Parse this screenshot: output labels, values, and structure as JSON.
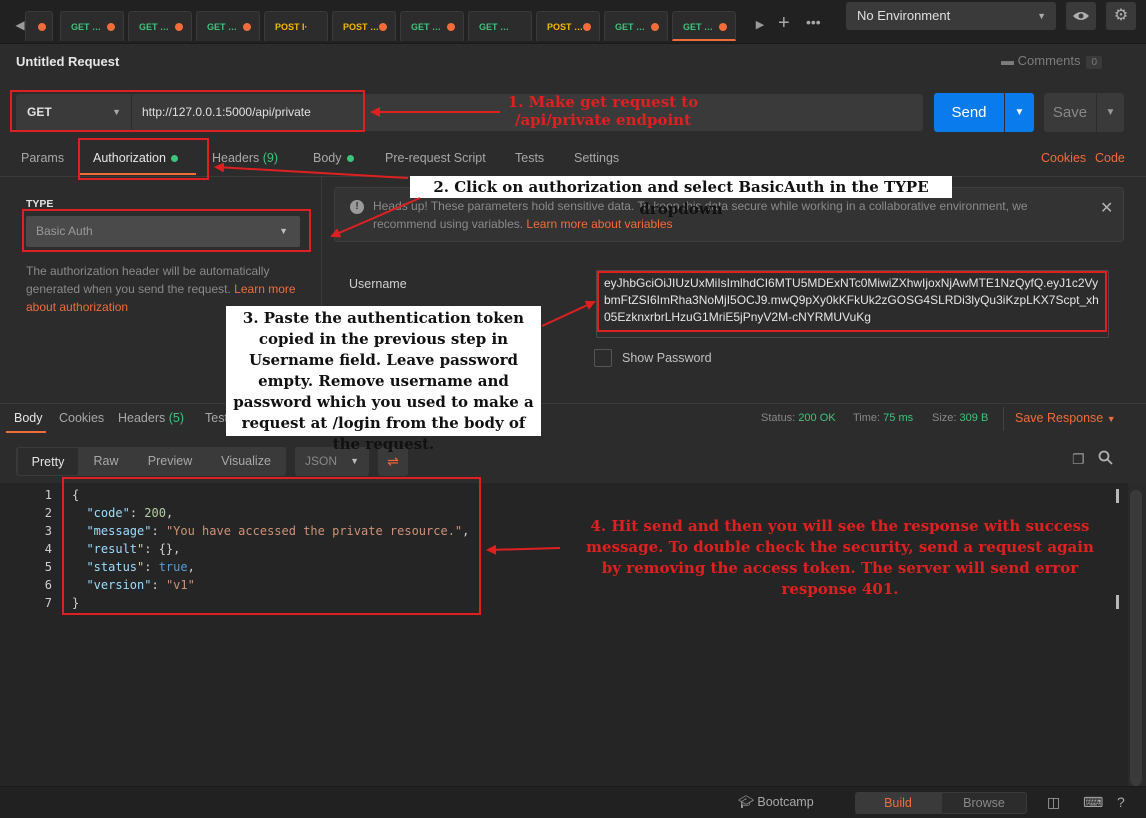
{
  "tabs": [
    {
      "method": "GET",
      "label": "GET …",
      "style": "get",
      "dot": true
    },
    {
      "method": "GET",
      "label": "GET …",
      "style": "get",
      "dot": true
    },
    {
      "method": "GET",
      "label": "GET …",
      "style": "get",
      "dot": true
    },
    {
      "method": "POST",
      "label": "POST I·",
      "style": "post",
      "dot": false
    },
    {
      "method": "POST",
      "label": "POST …",
      "style": "post",
      "dot": true
    },
    {
      "method": "GET",
      "label": "GET …",
      "style": "get",
      "dot": true
    },
    {
      "method": "GET",
      "label": "GET …",
      "style": "get",
      "dot": false
    },
    {
      "method": "POST",
      "label": "POST …",
      "style": "post",
      "dot": true
    },
    {
      "method": "GET",
      "label": "GET …",
      "style": "get",
      "dot": true
    },
    {
      "method": "GET",
      "label": "GET …",
      "style": "get",
      "dot": true
    }
  ],
  "environment": {
    "selected": "No Environment"
  },
  "request": {
    "title": "Untitled Request",
    "comments_label": "Comments",
    "comments_count": "0",
    "method": "GET",
    "url": "http://127.0.0.1:5000/api/private",
    "send_label": "Send",
    "save_label": "Save"
  },
  "request_tabs": {
    "params": "Params",
    "authorization": "Authorization",
    "headers": "Headers",
    "headers_count": "(9)",
    "body": "Body",
    "prerequest": "Pre-request Script",
    "tests": "Tests",
    "settings": "Settings",
    "cookies": "Cookies",
    "code": "Code"
  },
  "auth": {
    "type_label": "TYPE",
    "type_value": "Basic Auth",
    "help_text": "The authorization header will be automatically generated when you send the request.",
    "help_link": "Learn more about authorization",
    "notice_text": "Heads up! These parameters hold sensitive data. To keep this data secure while working in a collaborative environment, we recommend using variables.",
    "notice_link": "Learn more about variables",
    "username_label": "Username",
    "username_value": "eyJhbGciOiJIUzUxMiIsImlhdCI6MTU5MDExNTc0MiwiZXhwIjoxNjAwMTE1NzQyfQ.eyJ1c2VybmFtZSI6ImRha3NoMjI5OCJ9.mwQ9pXy0kKFkUk2zGOSG4SLRDi3lyQu3iKzpLKX7Scpt_xh05EzknxrbrLHzuG1MriE5jPnyV2M-cNYRMUVuKg",
    "show_password_label": "Show Password"
  },
  "response": {
    "tabs": {
      "body": "Body",
      "cookies": "Cookies",
      "headers": "Headers",
      "headers_count": "(5)",
      "tests": "Test Results"
    },
    "status_label": "Status:",
    "status_value": "200 OK",
    "time_label": "Time:",
    "time_value": "75 ms",
    "size_label": "Size:",
    "size_value": "309 B",
    "save_response": "Save Response",
    "views": {
      "pretty": "Pretty",
      "raw": "Raw",
      "preview": "Preview",
      "visualize": "Visualize"
    },
    "format": "JSON",
    "lines": [
      {
        "n": "1",
        "text": "{"
      },
      {
        "n": "2",
        "key": "\"code\"",
        "value": "200",
        "vtype": "n"
      },
      {
        "n": "3",
        "key": "\"message\"",
        "value": "\"You have accessed the private resource.\"",
        "vtype": "s"
      },
      {
        "n": "4",
        "key": "\"result\"",
        "value": "{}",
        "vtype": "p"
      },
      {
        "n": "5",
        "key": "\"status\"",
        "value": "true",
        "vtype": "b"
      },
      {
        "n": "6",
        "key": "\"version\"",
        "value": "\"v1\"",
        "vtype": "s",
        "last": true
      },
      {
        "n": "7",
        "text": "}"
      }
    ]
  },
  "statusbar": {
    "bootcamp": "Bootcamp",
    "build": "Build",
    "browse": "Browse"
  },
  "annotations": {
    "step1": "1. Make get request to /api/private endpoint",
    "step2": "2. Click on authorization and select BasicAuth in the TYPE dropdown",
    "step3": "3. Paste the authentication token copied in the previous step in Username field. Leave password empty. Remove username and password which you used to make a request at /login from the body of the request.",
    "step4": "4. Hit send and then you will see the response with success message. To double check the security, send a request again by removing the access token. The server will send error response 401."
  },
  "colors": {
    "accent": "#f26b3a",
    "send": "#097bed",
    "success": "#3ec47b",
    "annotation": "#e02020"
  }
}
